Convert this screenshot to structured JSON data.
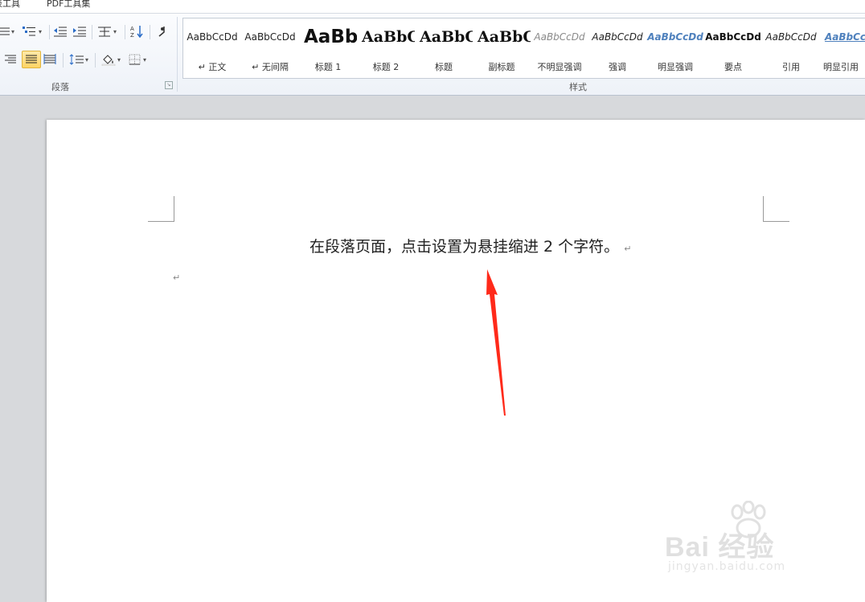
{
  "tabs": {
    "left_partial": "表工具",
    "pdf": "PDF工具集"
  },
  "ribbon": {
    "paragraph_group_label": "段落",
    "styles_group_label": "样式",
    "styles": [
      {
        "sample": "AaBbCcDd",
        "name": "↵ 正文"
      },
      {
        "sample": "AaBbCcDd",
        "name": "↵ 无间隔"
      },
      {
        "sample": "AaBb",
        "name": "标题 1"
      },
      {
        "sample": "AaBbC",
        "name": "标题 2"
      },
      {
        "sample": "AaBbC",
        "name": "标题"
      },
      {
        "sample": "AaBbC",
        "name": "副标题"
      },
      {
        "sample": "AaBbCcDd",
        "name": "不明显强调"
      },
      {
        "sample": "AaBbCcDd",
        "name": "强调"
      },
      {
        "sample": "AaBbCcDd",
        "name": "明显强调"
      },
      {
        "sample": "AaBbCcDd",
        "name": "要点"
      },
      {
        "sample": "AaBbCcDd",
        "name": "引用"
      },
      {
        "sample": "AaBbCcDd",
        "name": "明显引用"
      }
    ]
  },
  "document": {
    "paragraph1": "在段落页面，点击设置为悬挂缩进 2 个字符。",
    "pilcrow": "↵"
  },
  "watermark": {
    "brand": "Bai 经验",
    "url": "jingyan.baidu.com"
  },
  "colors": {
    "annotation_arrow": "#ff2a1a",
    "active_button": "#ffd564"
  }
}
